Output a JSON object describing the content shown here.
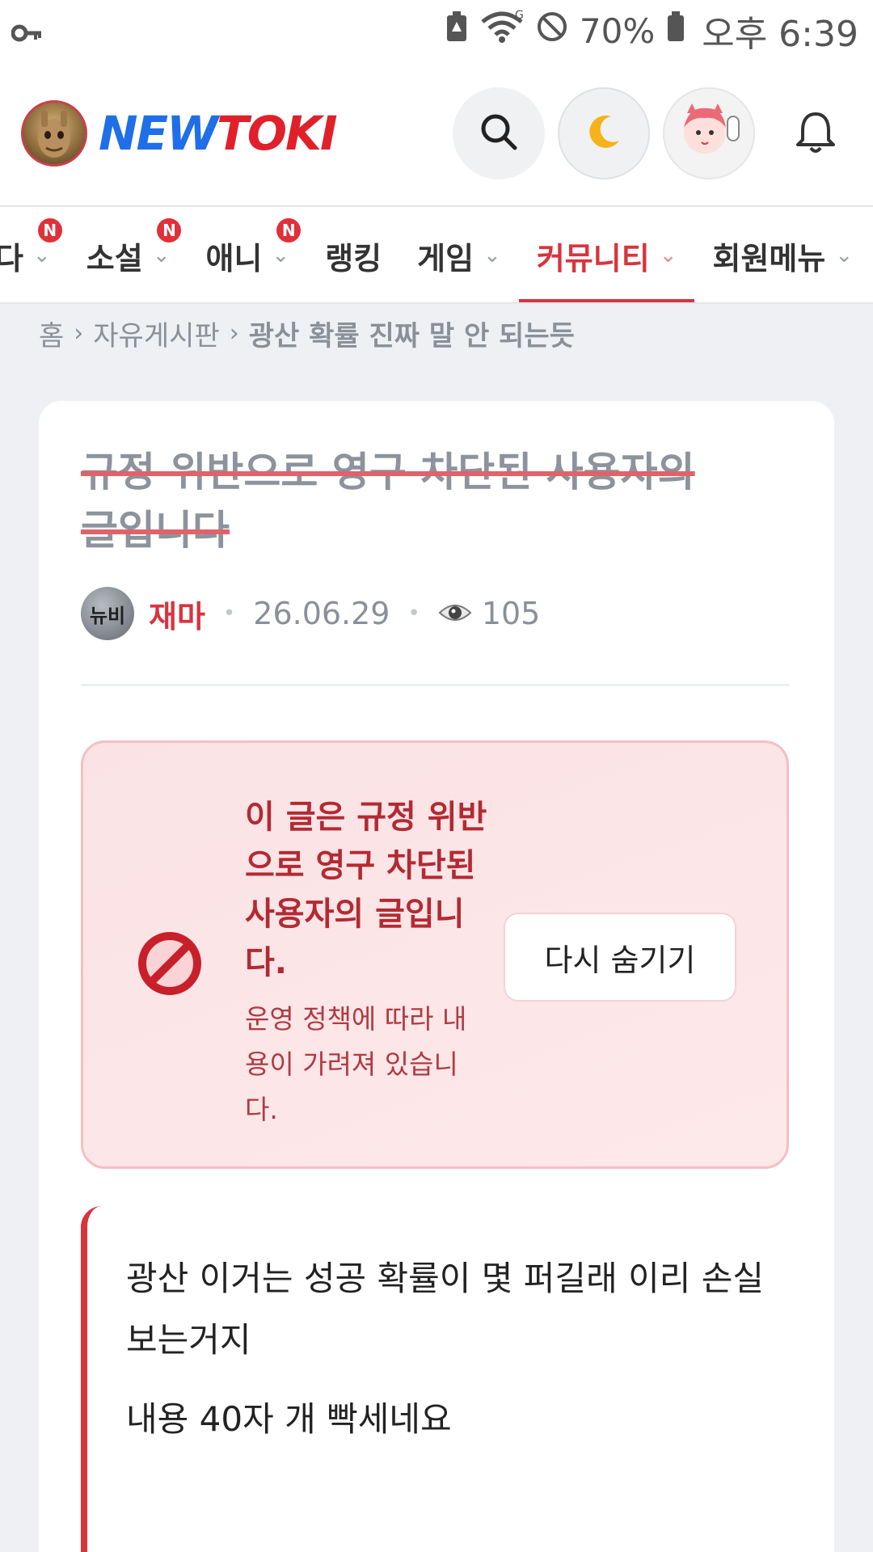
{
  "status_bar": {
    "battery_percent": "70%",
    "time": "오후 6:39",
    "icons": [
      "key-icon",
      "battery-saver-icon",
      "wifi-icon",
      "do-not-disturb-icon",
      "battery-icon"
    ]
  },
  "header": {
    "logo_new": "NEW",
    "logo_toki": "TOKI",
    "icons": [
      "search-icon",
      "moon-icon",
      "user-avatar",
      "bell-icon"
    ]
  },
  "nav": {
    "items": [
      {
        "label": "다",
        "badge": "N"
      },
      {
        "label": "소설",
        "badge": "N"
      },
      {
        "label": "애니",
        "badge": "N"
      },
      {
        "label": "랭킹",
        "badge": ""
      },
      {
        "label": "게임",
        "badge": ""
      },
      {
        "label": "커뮤니티",
        "badge": ""
      },
      {
        "label": "회원메뉴",
        "badge": ""
      }
    ],
    "active": "커뮤니티"
  },
  "breadcrumb": {
    "home": "홈",
    "board": "자유게시판",
    "current": "광산 확률 진짜 말 안 되는듯"
  },
  "post": {
    "title_line1": "규정 위반으로 영구 차단된 사용자의",
    "title_line2": "글입니다",
    "level_badge": "뉴비",
    "author": "재마",
    "date": "26.06.29",
    "views": "105",
    "notice": {
      "title": "이 글은 규정 위반으로 영구 차단된 사용자의 글입니다.",
      "subtitle": "운영 정책에 따라 내용이 가려져 있습니다.",
      "button": "다시 숨기기"
    },
    "body": [
      "광산 이거는 성공 확률이 몇 퍼길래 이리 손실보는거지",
      "내용 40자 개 빡세네요"
    ]
  },
  "colors": {
    "accent": "#d8343e",
    "logo_blue": "#1e6fe8",
    "logo_red": "#e0202a",
    "notice_bg": "#fbe3e5",
    "muted": "#8a9099"
  }
}
